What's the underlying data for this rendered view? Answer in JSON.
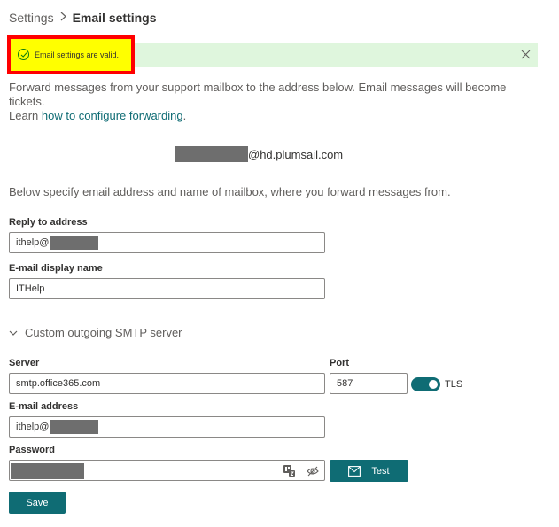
{
  "breadcrumb": {
    "root": "Settings",
    "current": "Email settings"
  },
  "banner": {
    "message": "Email settings are valid."
  },
  "intro": {
    "line1": "Forward messages from your support mailbox to the address below. Email messages will become tickets.",
    "learn_prefix": "Learn ",
    "learn_link": "how to configure forwarding",
    "learn_suffix": "."
  },
  "forwarding": {
    "domain": "@hd.plumsail.com"
  },
  "instructions": "Below specify email address and name of mailbox, where you forward messages from.",
  "reply_to": {
    "label": "Reply to address",
    "value": "ithelp@"
  },
  "display_name": {
    "label": "E-mail display name",
    "value": "ITHelp"
  },
  "smtp": {
    "section_label": "Custom outgoing SMTP server",
    "server_label": "Server",
    "server_value": "smtp.office365.com",
    "port_label": "Port",
    "port_value": "587",
    "tls_label": "TLS",
    "tls_enabled": true,
    "email_label": "E-mail address",
    "email_value": "ithelp@",
    "password_label": "Password",
    "test_label": "Test"
  },
  "save_label": "Save",
  "colors": {
    "accent": "#0f6c74",
    "success_bg": "#dff6dd",
    "success_icon": "#107c10"
  }
}
